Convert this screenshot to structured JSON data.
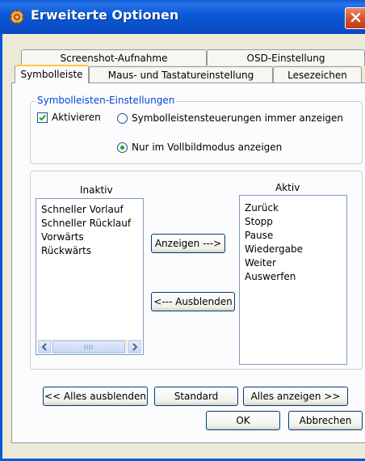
{
  "window": {
    "title": "Erweiterte Optionen"
  },
  "tabs": {
    "row_back": [
      "Screenshot-Aufnahme",
      "OSD-Einstellung"
    ],
    "row_front": [
      "Symbolleiste",
      "Maus- und Tastatureinstellung",
      "Lesezeichen"
    ],
    "active": "Symbolleiste"
  },
  "settings_group": {
    "title": "Symbolleisten-Einstellungen",
    "activate_label": "Aktivieren",
    "activate_checked": true,
    "radio_always_label": "Symbolleistensteuerungen immer anzeigen",
    "radio_fullscreen_label": "Nur im Vollbildmodus anzeigen",
    "selected_radio": "Nur im Vollbildmodus anzeigen"
  },
  "lists": {
    "inactive_header": "Inaktiv",
    "active_header": "Aktiv",
    "inactive_items": [
      "Schneller Vorlauf",
      "Schneller Rücklauf",
      "Vorwärts",
      "Rückwärts"
    ],
    "active_items": [
      "Zurück",
      "Stopp",
      "Pause",
      "Wiedergabe",
      "Weiter",
      "Auswerfen"
    ]
  },
  "buttons": {
    "show": "Anzeigen --->",
    "hide": "<--- Ausblenden",
    "hide_all": "<< Alles ausblenden",
    "standard": "Standard",
    "show_all": "Alles anzeigen >>",
    "ok": "OK",
    "cancel": "Abbrechen"
  },
  "icons": {
    "title": "settings-gear-icon",
    "close": "close-icon",
    "scroll_left": "arrow-left-icon",
    "scroll_right": "arrow-right-icon"
  },
  "colors": {
    "titlebar": "#0a5bd6",
    "group_title": "#0046d5",
    "close_button": "#d4552c",
    "active_tab_accent": "#ffc83c"
  }
}
